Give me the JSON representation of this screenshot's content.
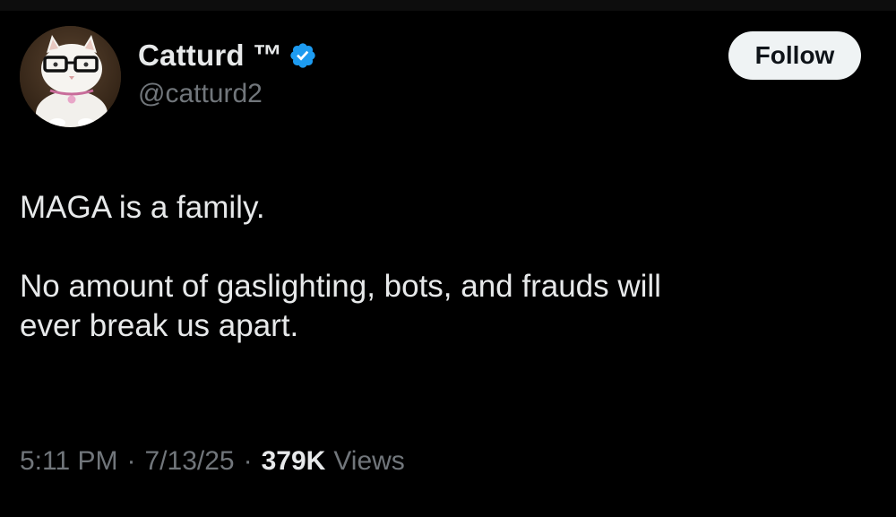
{
  "author": {
    "display_name": "Catturd ™",
    "handle": "@catturd2",
    "verified": true
  },
  "follow_button": {
    "label": "Follow"
  },
  "tweet": {
    "lines": [
      "MAGA is a family.",
      "No amount of gaslighting, bots, and frauds will",
      "ever break us apart."
    ]
  },
  "meta": {
    "time": "5:11 PM",
    "separator": "·",
    "date": "7/13/25",
    "views_count": "379K",
    "views_label": "Views"
  },
  "colors": {
    "background": "#000000",
    "primary_text": "#e7e9ea",
    "secondary_text": "#71767b",
    "verified_badge": "#1d9bf0",
    "follow_button_bg": "#eff3f4"
  },
  "icons": {
    "avatar": "cat-with-glasses-avatar",
    "verified": "verified-badge-icon"
  }
}
